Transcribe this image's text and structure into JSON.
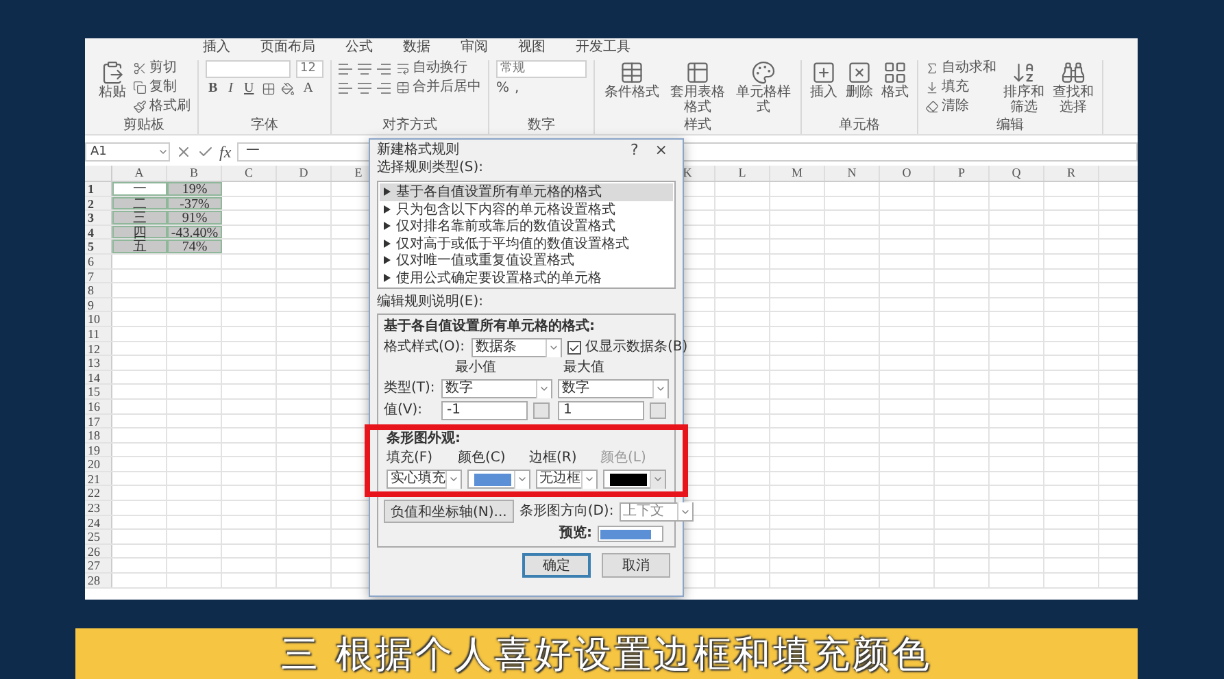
{
  "ribbon_tabs": [
    "插入",
    "页面布局",
    "公式",
    "数据",
    "审阅",
    "视图",
    "开发工具"
  ],
  "ribbon": {
    "groups": [
      {
        "kind": "clipboard",
        "label": "剪贴板",
        "large": "粘贴",
        "items": [
          "剪切",
          "复制",
          "格式刷"
        ]
      },
      {
        "kind": "font",
        "label": "字体",
        "font_size": "12",
        "styles": [
          "B",
          "I",
          "U"
        ],
        "color_letter": "A"
      },
      {
        "kind": "alignment",
        "label": "对齐方式",
        "items": [
          "自动换行",
          "合并后居中"
        ]
      },
      {
        "kind": "number",
        "label": "数字",
        "format": "常规",
        "symbols": [
          "%",
          ","
        ]
      },
      {
        "kind": "styles",
        "label": "样式",
        "buttons": [
          "条件格式",
          "套用表格格式",
          "单元格样式"
        ]
      },
      {
        "kind": "cells",
        "label": "单元格",
        "buttons": [
          "插入",
          "删除",
          "格式"
        ]
      },
      {
        "kind": "editing",
        "label": "编辑",
        "items": [
          "自动求和",
          "填充",
          "清除"
        ],
        "buttons": [
          "排序和筛选",
          "查找和选择"
        ]
      }
    ]
  },
  "formula_bar": {
    "name_box": "A1",
    "fx": "fx",
    "value": "一"
  },
  "sheet": {
    "columns_left": [
      "A",
      "B",
      "C",
      "D",
      "E"
    ],
    "columns_right": [
      "K",
      "L",
      "M",
      "N",
      "O",
      "P",
      "Q",
      "R"
    ],
    "rows": [
      {
        "number": "1",
        "cells": [
          {
            "value": "一",
            "selected": true,
            "active": true
          },
          {
            "value": "19%",
            "selected": true,
            "active": false
          }
        ]
      },
      {
        "number": "2",
        "cells": [
          {
            "value": "二",
            "selected": true,
            "active": false
          },
          {
            "value": "-37%",
            "selected": true,
            "active": false
          }
        ]
      },
      {
        "number": "3",
        "cells": [
          {
            "value": "三",
            "selected": true,
            "active": false
          },
          {
            "value": "91%",
            "selected": true,
            "active": false
          }
        ]
      },
      {
        "number": "4",
        "cells": [
          {
            "value": "四",
            "selected": true,
            "active": false
          },
          {
            "value": "-43.40%",
            "selected": true,
            "active": false
          }
        ]
      },
      {
        "number": "5",
        "cells": [
          {
            "value": "五",
            "selected": true,
            "active": false
          },
          {
            "value": "74%",
            "selected": true,
            "active": false
          }
        ]
      },
      {
        "number": "6"
      },
      {
        "number": "7"
      },
      {
        "number": "8"
      },
      {
        "number": "9"
      },
      {
        "number": "10"
      },
      {
        "number": "11"
      },
      {
        "number": "12"
      },
      {
        "number": "13"
      },
      {
        "number": "14"
      },
      {
        "number": "15"
      },
      {
        "number": "16"
      },
      {
        "number": "17"
      },
      {
        "number": "18"
      },
      {
        "number": "19"
      },
      {
        "number": "20"
      },
      {
        "number": "21"
      },
      {
        "number": "22"
      },
      {
        "number": "23"
      },
      {
        "number": "24"
      },
      {
        "number": "25"
      },
      {
        "number": "26"
      },
      {
        "number": "27"
      },
      {
        "number": "28"
      }
    ]
  },
  "dialog": {
    "title": "新建格式规则",
    "help": "?",
    "close": "×",
    "rule_type_label": "选择规则类型(S):",
    "rule_types": [
      {
        "label": "基于各自值设置所有单元格的格式",
        "selected": true
      },
      {
        "label": "只为包含以下内容的单元格设置格式",
        "selected": false
      },
      {
        "label": "仅对排名靠前或靠后的数值设置格式",
        "selected": false
      },
      {
        "label": "仅对高于或低于平均值的数值设置格式",
        "selected": false
      },
      {
        "label": "仅对唯一值或重复值设置格式",
        "selected": false
      },
      {
        "label": "使用公式确定要设置格式的单元格",
        "selected": false
      }
    ],
    "edit_label": "编辑规则说明(E):",
    "heading": "基于各自值设置所有单元格的格式:",
    "format_style": {
      "label": "格式样式(O):",
      "value": "数据条"
    },
    "show_bar_only": {
      "label": "仅显示数据条(B)",
      "checked": true
    },
    "type_label": "类型(T):",
    "value_label": "值(V):",
    "min": {
      "heading": "最小值",
      "type": "数字",
      "value": "-1"
    },
    "max": {
      "heading": "最大值",
      "type": "数字",
      "value": "1"
    },
    "bar_appearance": {
      "heading": "条形图外观:",
      "highlighted": true,
      "fill": {
        "label": "填充(F)",
        "value": "实心填充"
      },
      "fill_color": {
        "label": "颜色(C)",
        "color": "#5b8fd6"
      },
      "border": {
        "label": "边框(R)",
        "value": "无边框"
      },
      "border_color": {
        "label": "颜色(L)",
        "color": "#000000",
        "disabled": true
      }
    },
    "negative_button": "负值和坐标轴(N)...",
    "direction": {
      "label": "条形图方向(D):",
      "value": "上下文"
    },
    "preview_label": "预览:",
    "buttons": [
      {
        "label": "确定",
        "default": true
      },
      {
        "label": "取消",
        "default": false
      }
    ]
  },
  "caption": "三 根据个人喜好设置边框和填充颜色"
}
